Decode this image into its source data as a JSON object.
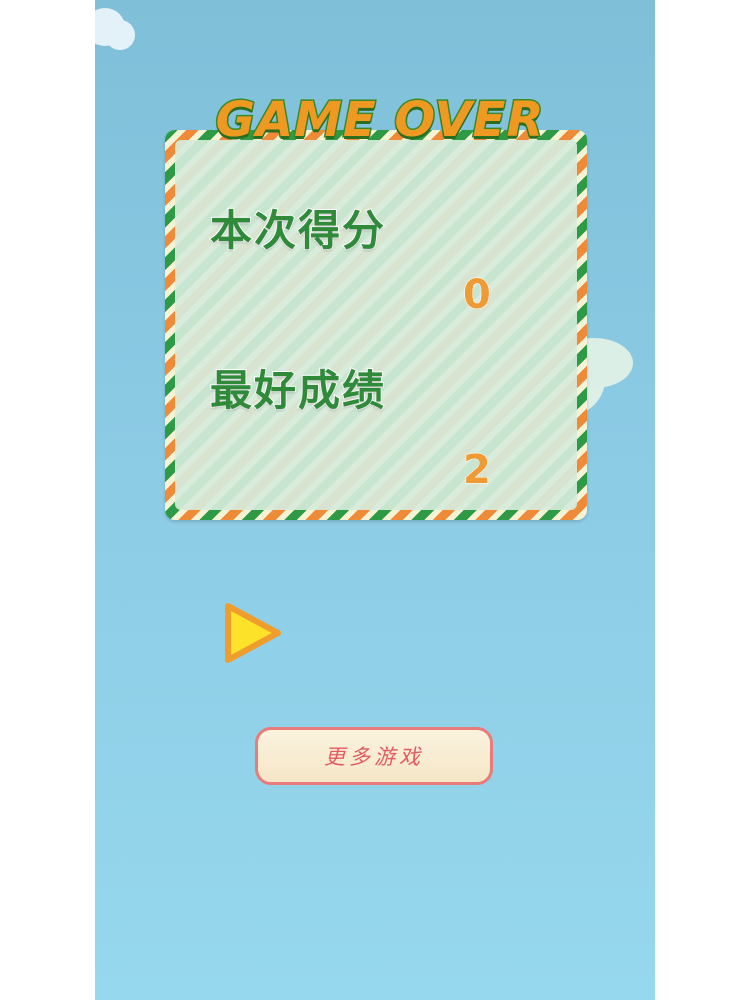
{
  "game": {
    "title": "GAME OVER",
    "current_score_label": "本次得分",
    "current_score_value": "0",
    "best_score_label": "最好成绩",
    "best_score_value": "2",
    "more_games_label": "更多游戏",
    "play_icon": "play-triangle-icon"
  },
  "colors": {
    "sky": "#8ccbe4",
    "panel_green": "#2f9a45",
    "panel_orange": "#ee8a38",
    "label_green": "#2f8a3a",
    "score_orange": "#ee9a35",
    "play_yellow": "#fde22a",
    "button_red": "#e25b63"
  }
}
